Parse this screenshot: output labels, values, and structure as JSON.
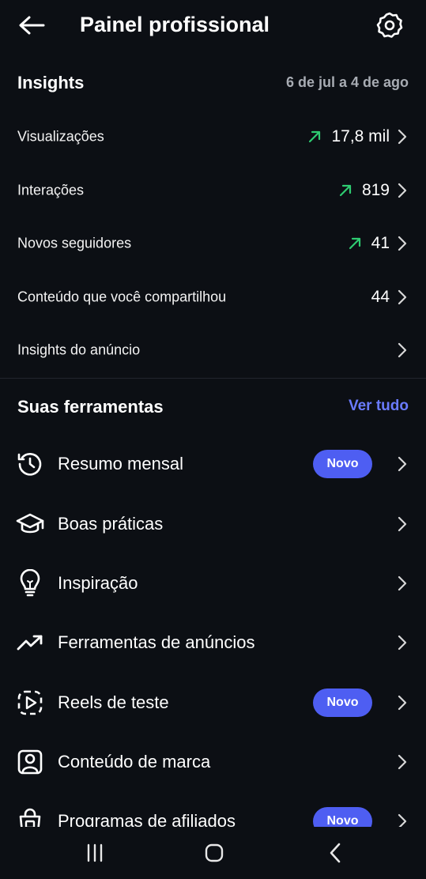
{
  "header": {
    "title": "Painel profissional",
    "back_icon": "arrow-left-icon",
    "settings_icon": "gear-icon"
  },
  "insights": {
    "title": "Insights",
    "date_range": "6 de jul a 4 de ago",
    "rows": [
      {
        "label": "Visualizações",
        "value": "17,8 mil",
        "trend": "up"
      },
      {
        "label": "Interações",
        "value": "819",
        "trend": "up"
      },
      {
        "label": "Novos seguidores",
        "value": "41",
        "trend": "up"
      },
      {
        "label": "Conteúdo que você compartilhou",
        "value": "44",
        "trend": ""
      },
      {
        "label": "Insights do anúncio",
        "value": "",
        "trend": ""
      }
    ]
  },
  "tools": {
    "title": "Suas ferramentas",
    "see_all": "Ver tudo",
    "items": [
      {
        "label": "Resumo mensal",
        "icon": "history-clock-icon",
        "badge": "Novo"
      },
      {
        "label": "Boas práticas",
        "icon": "graduation-cap-icon",
        "badge": ""
      },
      {
        "label": "Inspiração",
        "icon": "lightbulb-icon",
        "badge": ""
      },
      {
        "label": "Ferramentas de anúncios",
        "icon": "trending-up-icon",
        "badge": ""
      },
      {
        "label": "Reels de teste",
        "icon": "dashed-play-icon",
        "badge": "Novo"
      },
      {
        "label": "Conteúdo de marca",
        "icon": "branded-content-icon",
        "badge": ""
      },
      {
        "label": "Programas de afiliados",
        "icon": "shopping-bag-icon",
        "badge": "Novo"
      }
    ]
  },
  "colors": {
    "background": "#0c0f14",
    "accent": "#4e5ef2",
    "link": "#6a7bff",
    "trend_up": "#2ecc71",
    "muted_text": "#a8acb3"
  },
  "navbar": {
    "recents_icon": "recents-icon",
    "home_icon": "home-icon",
    "back_icon": "nav-back-icon"
  }
}
